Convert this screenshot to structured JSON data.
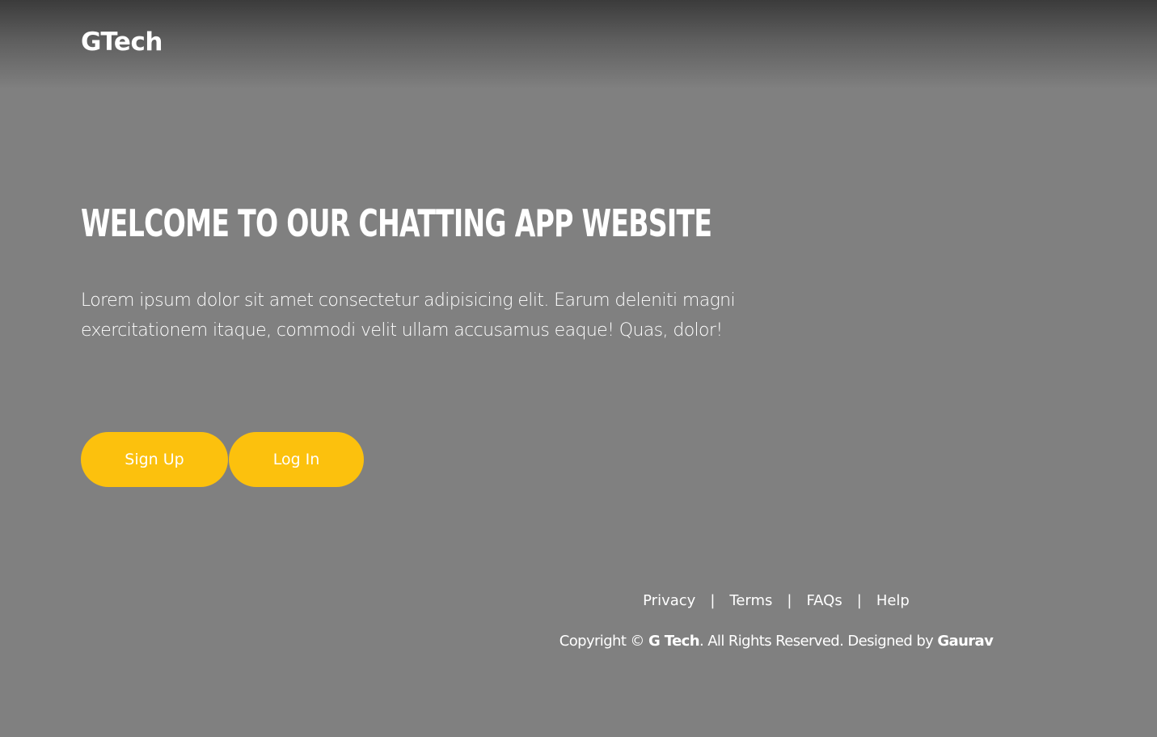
{
  "header": {
    "logo": "GTech"
  },
  "hero": {
    "title": "Welcome to our chatting app website",
    "text": "Lorem ipsum dolor sit amet consectetur adipisicing elit. Earum deleniti magni exercitationem itaque, commodi velit ullam accusamus eaque! Quas, dolor!"
  },
  "buttons": {
    "signup": "Sign Up",
    "login": "Log In"
  },
  "footer": {
    "links": [
      "Privacy",
      "Terms",
      "FAQs",
      "Help"
    ],
    "separator": "|",
    "copyright": {
      "prefix": "Copyright © ",
      "company": "G Tech",
      "middle": ". All Rights Reserved. Designed by ",
      "designer": "Gaurav"
    }
  },
  "colors": {
    "background": "#808080",
    "accent": "#fcc10d",
    "text": "#ffffff"
  }
}
